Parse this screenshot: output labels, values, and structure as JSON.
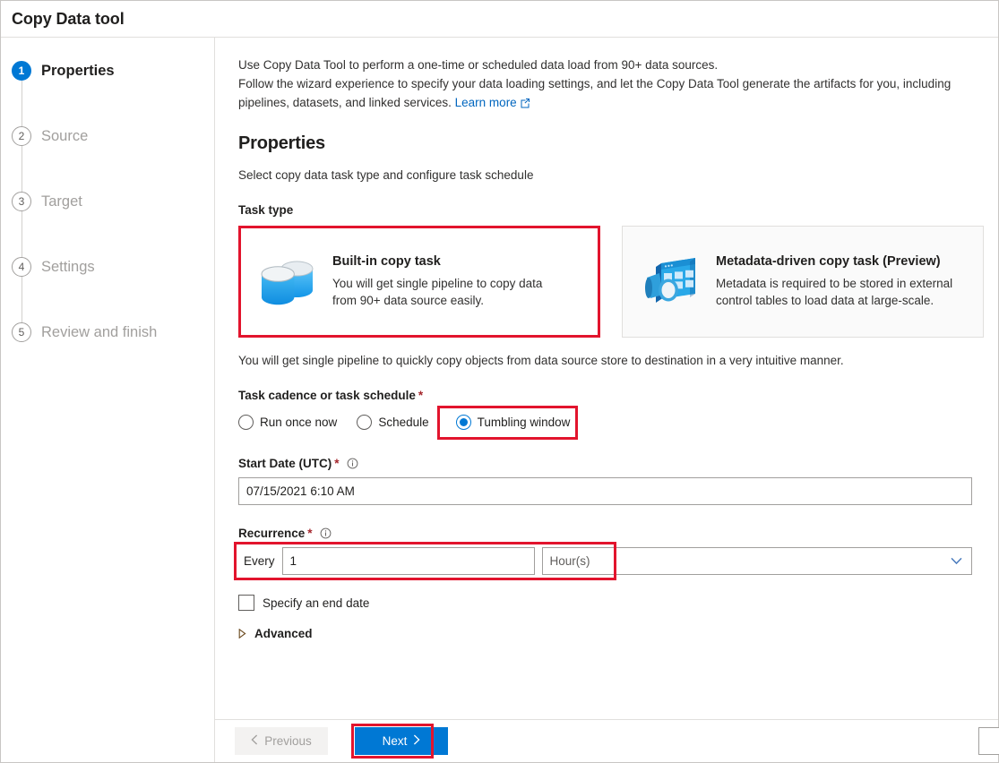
{
  "window": {
    "title": "Copy Data tool"
  },
  "sidebar": {
    "items": [
      {
        "num": "1",
        "label": "Properties",
        "state": "active"
      },
      {
        "num": "2",
        "label": "Source",
        "state": "inactive"
      },
      {
        "num": "3",
        "label": "Target",
        "state": "inactive"
      },
      {
        "num": "4",
        "label": "Settings",
        "state": "inactive"
      },
      {
        "num": "5",
        "label": "Review and finish",
        "state": "inactive"
      }
    ]
  },
  "intro": {
    "line1": "Use Copy Data Tool to perform a one-time or scheduled data load from 90+ data sources.",
    "line2": "Follow the wizard experience to specify your data loading settings, and let the Copy Data Tool generate the artifacts for you, including pipelines, datasets, and linked services.",
    "link_label": "Learn more",
    "link_icon": "external-link-icon"
  },
  "section": {
    "title": "Properties",
    "subtitle": "Select copy data task type and configure task schedule"
  },
  "task_type": {
    "label": "Task type",
    "cards": [
      {
        "icon": "database-copy-icon",
        "title": "Built-in copy task",
        "desc": "You will get single pipeline to copy data from 90+ data source easily.",
        "selected": true
      },
      {
        "icon": "metadata-table-search-icon",
        "title": "Metadata-driven copy task (Preview)",
        "desc": "Metadata is required to be stored in external control tables to load data at large-scale.",
        "selected": false
      }
    ],
    "note": "You will get single pipeline to quickly copy objects from data source store to destination in a very intuitive manner."
  },
  "cadence": {
    "label": "Task cadence or task schedule",
    "required": "*",
    "options": [
      {
        "label": "Run once now",
        "checked": false
      },
      {
        "label": "Schedule",
        "checked": false
      },
      {
        "label": "Tumbling window",
        "checked": true
      }
    ]
  },
  "start_date": {
    "label": "Start Date (UTC)",
    "required": "*",
    "info_icon": "info-icon",
    "value": "07/15/2021 6:10 AM"
  },
  "recurrence": {
    "label": "Recurrence",
    "required": "*",
    "info_icon": "info-icon",
    "every_label": "Every",
    "interval_value": "1",
    "unit_value": "Hour(s)",
    "unit_chevron": "chevron-down-icon"
  },
  "end_date": {
    "label": "Specify an end date",
    "checked": false
  },
  "advanced": {
    "label": "Advanced",
    "caret_icon": "caret-right-icon",
    "expanded": false
  },
  "footer": {
    "previous_label": "Previous",
    "previous_icon": "chevron-left-icon",
    "next_label": "Next",
    "next_icon": "chevron-right-icon"
  },
  "colors": {
    "accent": "#0078d4",
    "highlight": "#e2142d",
    "required": "#a4262c",
    "link": "#0066bf"
  }
}
